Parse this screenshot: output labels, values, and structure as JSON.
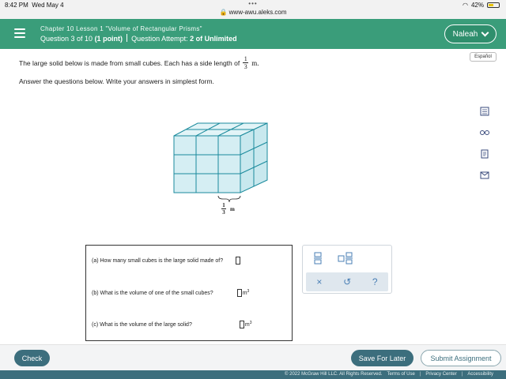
{
  "statusbar": {
    "time": "8:42 PM",
    "day": "Wed May 4",
    "dots": "•••",
    "url": "www-awu.aleks.com",
    "battery": "42%"
  },
  "header": {
    "chapter": "Chapter 10 Lesson 1 \"Volume of Rectangular Prisms\"",
    "question_label": "Question 3 of 10",
    "points": "(1 point)",
    "attempt_label": "Question Attempt:",
    "attempt_value": "2 of Unlimited",
    "user": "Naleah"
  },
  "espanol": "Español",
  "problem": {
    "text": "The large solid below is made from small cubes. Each has a side length of",
    "frac_num": "1",
    "frac_den": "3",
    "unit": "m.",
    "instruction": "Answer the questions below. Write your answers in simplest form."
  },
  "figure": {
    "label_num": "1",
    "label_den": "3",
    "label_unit": "m"
  },
  "questions": [
    {
      "text": "(a) How many small cubes is the large solid made of?"
    },
    {
      "text": "(b) What is the volume of one of the small cubes?",
      "unit": "m",
      "exp": "3"
    },
    {
      "text": "(c) What is the volume of the large solid?",
      "unit": "m",
      "exp": "3"
    }
  ],
  "tools": {
    "clear": "×",
    "undo": "↺",
    "help": "?"
  },
  "footer": {
    "check": "Check",
    "save": "Save For Later",
    "submit": "Submit Assignment"
  },
  "legal": {
    "copyright": "© 2022 McGraw Hill LLC. All Rights Reserved.",
    "terms": "Terms of Use",
    "privacy": "Privacy Center",
    "access": "Accessibility"
  },
  "icons": [
    "calculator-icon",
    "glasses-icon",
    "notes-icon",
    "mail-icon",
    "menu-icon",
    "chevron-down-icon",
    "fraction-icon",
    "mixed-number-icon"
  ]
}
